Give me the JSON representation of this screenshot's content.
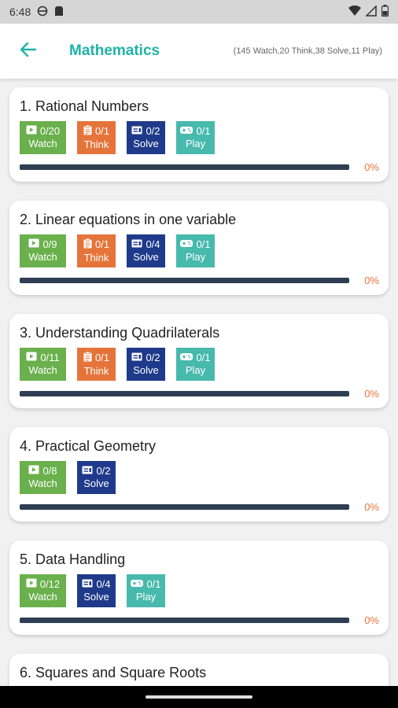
{
  "status_bar": {
    "time": "6:48",
    "icons": [
      "vpn-globe-icon",
      "sim-icon",
      "wifi-icon",
      "signal-icon",
      "battery-icon"
    ]
  },
  "header": {
    "back_icon": "arrow-left-icon",
    "title": "Mathematics",
    "summary": "(145 Watch,20 Think,38 Solve,11 Play)"
  },
  "colors": {
    "accent": "#1fb3a6",
    "watch": "#6ab04c",
    "think": "#e5743b",
    "solve": "#1f3a8a",
    "play": "#48b9ad",
    "progress_track": "#2f3e52",
    "progress_text": "#e5743b"
  },
  "chapters": [
    {
      "title": "1. Rational Numbers",
      "progress": 0,
      "progress_text": "0%",
      "badges": [
        {
          "type": "watch",
          "count": "0/20",
          "label": "Watch"
        },
        {
          "type": "think",
          "count": "0/1",
          "label": "Think"
        },
        {
          "type": "solve",
          "count": "0/2",
          "label": "Solve"
        },
        {
          "type": "play",
          "count": "0/1",
          "label": "Play"
        }
      ]
    },
    {
      "title": "2. Linear equations in one variable",
      "progress": 0,
      "progress_text": "0%",
      "badges": [
        {
          "type": "watch",
          "count": "0/9",
          "label": "Watch"
        },
        {
          "type": "think",
          "count": "0/1",
          "label": "Think"
        },
        {
          "type": "solve",
          "count": "0/4",
          "label": "Solve"
        },
        {
          "type": "play",
          "count": "0/1",
          "label": "Play"
        }
      ]
    },
    {
      "title": "3. Understanding Quadrilaterals",
      "progress": 0,
      "progress_text": "0%",
      "badges": [
        {
          "type": "watch",
          "count": "0/11",
          "label": "Watch"
        },
        {
          "type": "think",
          "count": "0/1",
          "label": "Think"
        },
        {
          "type": "solve",
          "count": "0/2",
          "label": "Solve"
        },
        {
          "type": "play",
          "count": "0/1",
          "label": "Play"
        }
      ]
    },
    {
      "title": "4. Practical Geometry",
      "progress": 0,
      "progress_text": "0%",
      "badges": [
        {
          "type": "watch",
          "count": "0/8",
          "label": "Watch"
        },
        {
          "type": "solve",
          "count": "0/2",
          "label": "Solve"
        }
      ]
    },
    {
      "title": "5. Data Handling",
      "progress": 0,
      "progress_text": "0%",
      "badges": [
        {
          "type": "watch",
          "count": "0/12",
          "label": "Watch"
        },
        {
          "type": "solve",
          "count": "0/4",
          "label": "Solve"
        },
        {
          "type": "play",
          "count": "0/1",
          "label": "Play"
        }
      ]
    },
    {
      "title": "6. Squares and Square Roots"
    }
  ]
}
